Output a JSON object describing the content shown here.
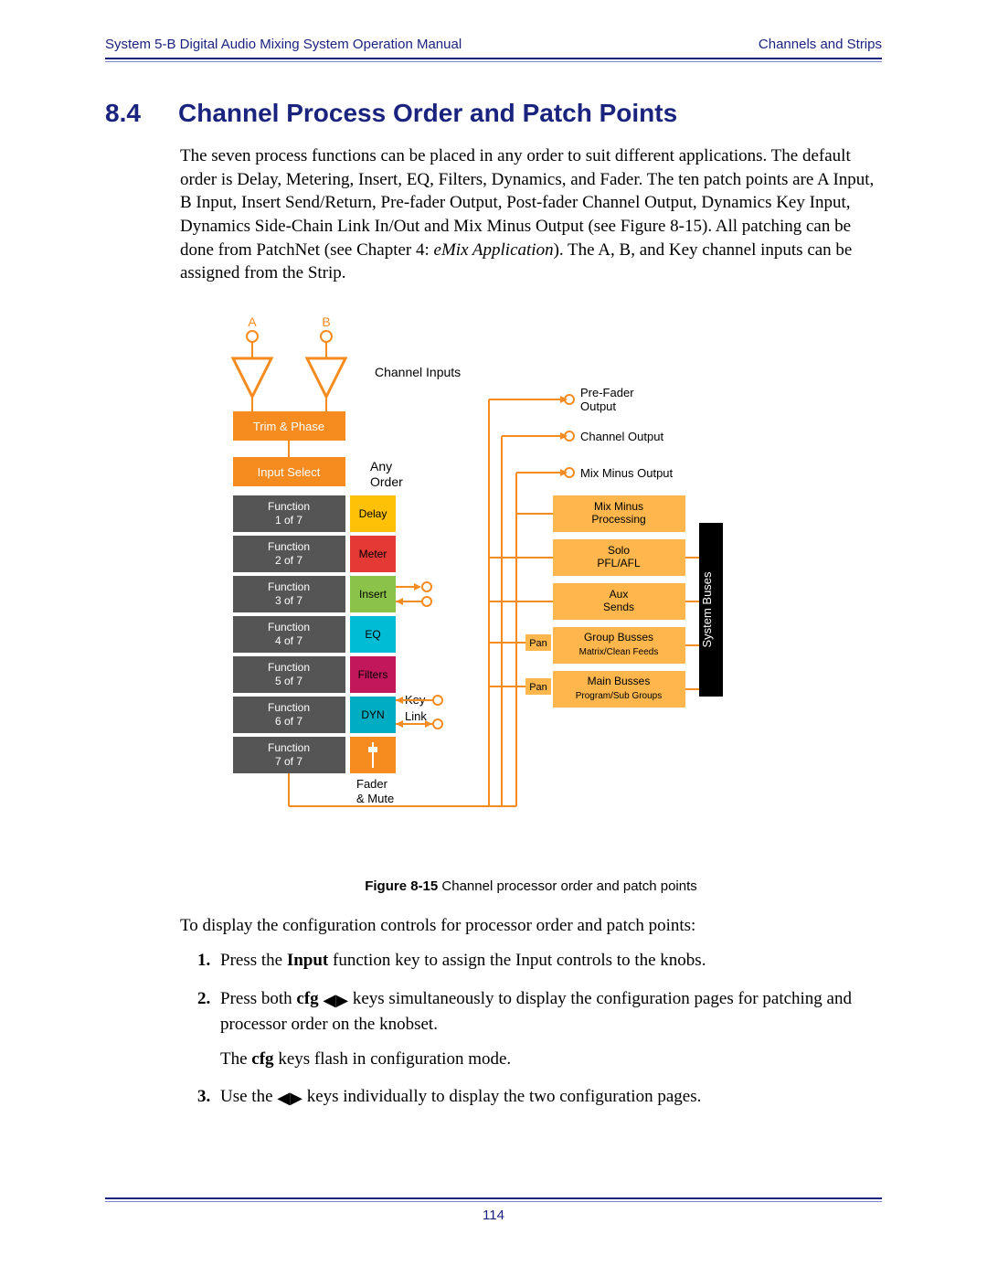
{
  "header": {
    "left": "System 5-B Digital Audio Mixing System Operation Manual",
    "right": "Channels and Strips"
  },
  "section": {
    "number": "8.4",
    "title": "Channel Process Order and Patch Points"
  },
  "intro": {
    "p1a": "The seven process functions can be placed in any order to suit different applications. The default order is Delay, Metering, Insert, EQ, Filters, Dynamics, and Fader. The ten patch points are A Input, B Input, Insert Send/Return, Pre-fader Output, Post-fader Channel Output, Dynamics Key Input, Dynamics Side-Chain Link In/Out and Mix Minus Output (see Figure 8-15). All patching can be done from PatchNet (see Chapter 4: ",
    "p1b": "eMix Application",
    "p1c": "). The A, B, and Key channel inputs can be assigned from the Strip."
  },
  "diagram": {
    "input_a": "A",
    "input_b": "B",
    "channel_inputs": "Channel  Inputs",
    "trim_phase": "Trim & Phase",
    "input_select": "Input Select",
    "any_order": "Any\nOrder",
    "func1": "Function\n1 of 7",
    "func2": "Function\n2 of 7",
    "func3": "Function\n3 of 7",
    "func4": "Function\n4 of 7",
    "func5": "Function\n5 of 7",
    "func6": "Function\n6 of 7",
    "func7": "Function\n7 of 7",
    "delay": "Delay",
    "meter": "Meter",
    "insert": "Insert",
    "eq": "EQ",
    "filters": "Filters",
    "dyn": "DYN",
    "fader_mute": "Fader\n& Mute",
    "key": "Key",
    "link": "Link",
    "prefader": "Pre-Fader\nOutput",
    "channel_out": "Channel Output",
    "mixminus_out": "Mix Minus Output",
    "mixminus_proc": "Mix Minus\nProcessing",
    "solo": "Solo\nPFL/AFL",
    "aux": "Aux\nSends",
    "group_busses": "Group Busses",
    "group_sub": "Matrix/Clean Feeds",
    "main_busses": "Main Busses",
    "main_sub": "Program/Sub Groups",
    "pan": "Pan",
    "system_buses": "System Buses"
  },
  "figure": {
    "label": "Figure 8-15",
    "caption": " Channel processor order and patch points"
  },
  "steps_intro": "To display the configuration controls for processor order and patch points:",
  "steps": {
    "s1a": "Press the ",
    "s1b": "Input",
    "s1c": " function key to assign the Input controls to the knobs.",
    "s2a": "Press both ",
    "s2b": "cfg",
    "s2c": " keys simultaneously to display the configuration pages for patching and processor order on the knobset.",
    "s2d": "The ",
    "s2e": "cfg",
    "s2f": " keys flash in configuration mode.",
    "s3a": "Use the ",
    "s3b": " keys individually to display the two configuration pages."
  },
  "page_number": "114"
}
